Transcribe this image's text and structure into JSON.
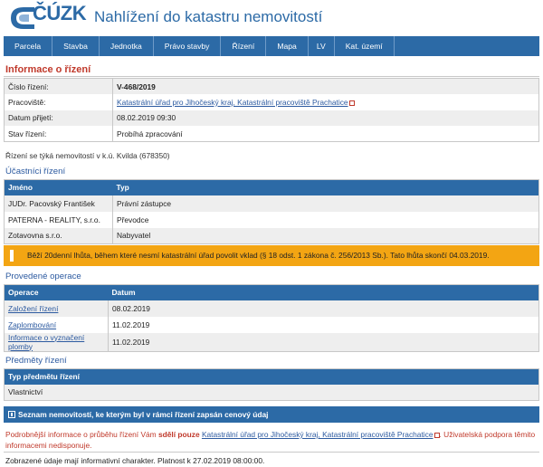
{
  "header": {
    "logo_text": "ČÚZK",
    "title": "Nahlížení do katastru nemovitostí"
  },
  "nav": [
    "Parcela",
    "Stavba",
    "Jednotka",
    "Právo stavby",
    "Řízení",
    "Mapa",
    "LV",
    "Kat. území"
  ],
  "info": {
    "title": "Informace o řízení",
    "rows": [
      {
        "key": "Číslo řízení:",
        "value": "V-468/2019"
      },
      {
        "key": "Pracoviště:",
        "value": "Katastrální úřad pro Jihočeský kraj, Katastrální pracoviště Prachatice"
      },
      {
        "key": "Datum přijetí:",
        "value": "08.02.2019 09:30"
      },
      {
        "key": "Stav řízení:",
        "value": "Probíhá zpracování"
      }
    ]
  },
  "note": "Řízení se týká nemovitostí v k.ú. Kvilda (678350)",
  "participants": {
    "title": "Účastníci řízení",
    "headers": [
      "Jméno",
      "Typ"
    ],
    "rows": [
      [
        "JUDr. Pacovský František",
        "Právní zástupce"
      ],
      [
        "PATERNA - REALITY, s.r.o.",
        "Převodce"
      ],
      [
        "Zotavovna s.r.o.",
        "Nabyvatel"
      ]
    ]
  },
  "warning": "Běží 20denní lhůta, během které nesmí katastrální úřad povolit vklad (§ 18 odst. 1 zákona č. 256/2013 Sb.). Tato lhůta skončí 04.03.2019.",
  "operations": {
    "title": "Provedené operace",
    "headers": [
      "Operace",
      "Datum"
    ],
    "rows": [
      [
        "Založení řízení",
        "08.02.2019"
      ],
      [
        "Zaplombování",
        "11.02.2019"
      ],
      [
        "Informace o vyznačení plomby",
        "11.02.2019"
      ]
    ]
  },
  "subjects": {
    "title": "Předměty řízení",
    "header": "Typ předmětu řízení",
    "rows": [
      "Vlastnictví"
    ]
  },
  "panel": "Seznam nemovitostí, ke kterým byl v rámci řízení zapsán cenový údaj",
  "info_text": {
    "part1": "Podrobnější informace o průběhu řízení Vám ",
    "bold": "sdělí pouze",
    "link": "Katastrální úřad pro Jihočeský kraj, Katastrální pracoviště Prachatice",
    "part2": ". Uživatelská podpora těmito informacemi nedisponuje."
  },
  "footer": "Zobrazené údaje mají informativní charakter. Platnost k 27.02.2019 08:00:00.",
  "colors": {
    "primary": "#2c6aa6",
    "warning": "#f3a513",
    "red": "#c0392b"
  }
}
